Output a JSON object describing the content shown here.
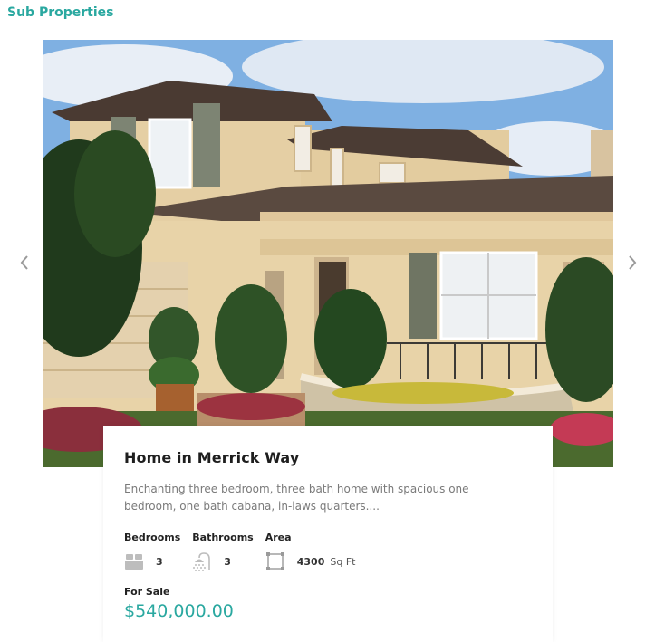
{
  "section": {
    "title": "Sub Properties"
  },
  "property": {
    "title": "Home in Merrick Way",
    "description": "Enchanting three bedroom, three bath home with spacious one bedroom, one bath cabana, in-laws quarters....",
    "features": {
      "bedrooms_label": "Bedrooms",
      "bedrooms_value": "3",
      "bathrooms_label": "Bathrooms",
      "bathrooms_value": "3",
      "area_label": "Area",
      "area_value": "4300",
      "area_unit": "Sq Ft"
    },
    "status": "For Sale",
    "price": "$540,000.00"
  },
  "icons": {
    "prev": "chevron-left-icon",
    "next": "chevron-right-icon",
    "bedrooms": "bed-icon",
    "bathrooms": "shower-icon",
    "area": "area-icon"
  },
  "colors": {
    "accent": "#2aa8a0"
  }
}
